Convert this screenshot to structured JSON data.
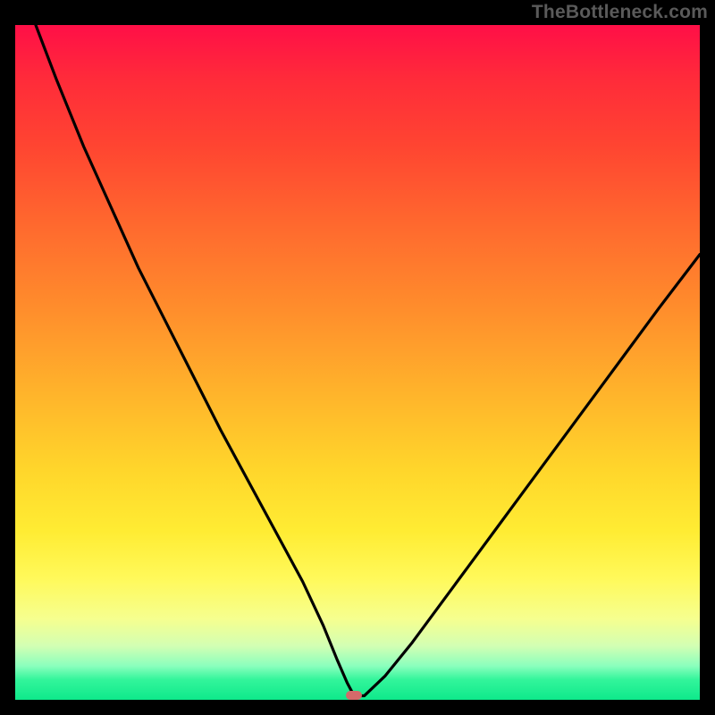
{
  "watermark": "TheBottleneck.com",
  "marker": {
    "x_percent": 49.5,
    "y_percent": 99.4
  },
  "colors": {
    "page_bg": "#000000",
    "watermark": "#5a5a5a",
    "marker": "#d46a6a",
    "curve": "#000000",
    "gradient_top": "#ff0f47",
    "gradient_bottom": "#0ee98b"
  },
  "chart_data": {
    "type": "line",
    "title": "",
    "xlabel": "",
    "ylabel": "",
    "xlim": [
      0,
      100
    ],
    "ylim": [
      0,
      100
    ],
    "grid": false,
    "legend": false,
    "notes": "Background is a vertical red→yellow→green gradient. Curve is drawn in black. A small rounded marker sits at the curve minimum near (49.5, 0.6).",
    "series": [
      {
        "name": "bottleneck-curve",
        "x": [
          0,
          3,
          6,
          10,
          14,
          18,
          22,
          26,
          30,
          34,
          38,
          42,
          45,
          47,
          48.5,
          49.5,
          51,
          54,
          58,
          62,
          66,
          70,
          74,
          78,
          82,
          86,
          90,
          94,
          97,
          100
        ],
        "y": [
          115,
          100,
          92,
          82,
          73,
          64,
          56,
          48,
          40,
          32.5,
          25,
          17.5,
          11,
          6,
          2.5,
          0.6,
          0.6,
          3.5,
          8.5,
          14,
          19.5,
          25,
          30.5,
          36,
          41.5,
          47,
          52.5,
          58,
          62,
          66
        ]
      }
    ],
    "marker_point": {
      "x": 49.5,
      "y": 0.6
    }
  }
}
